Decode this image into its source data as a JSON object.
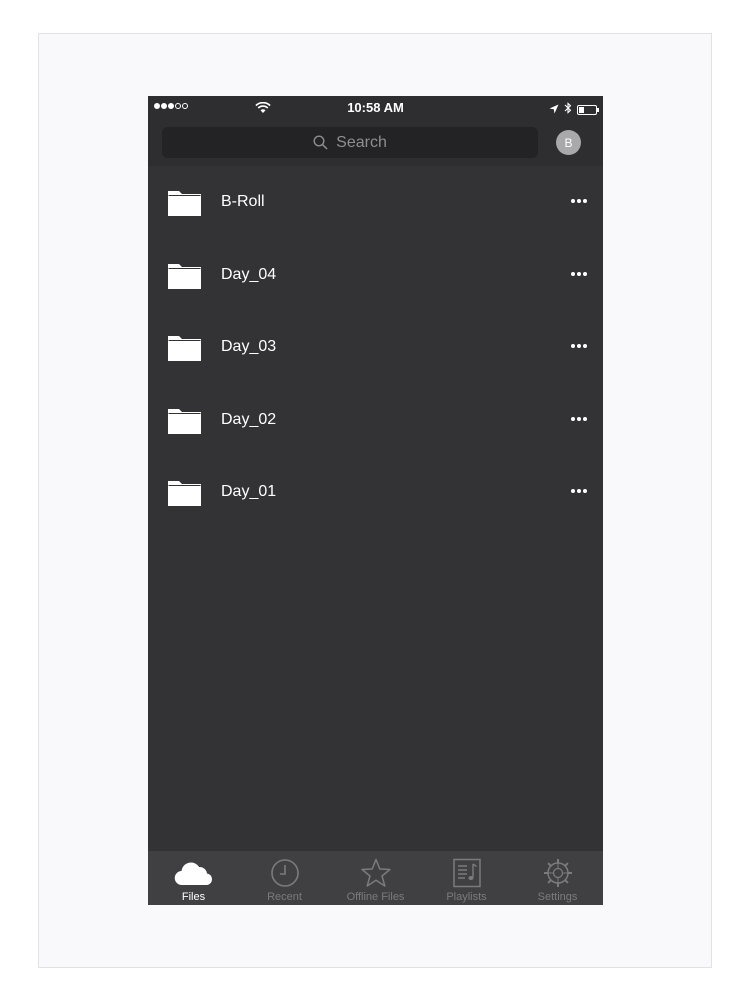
{
  "status_bar": {
    "time": "10:58 AM",
    "signal_bars_filled": 3,
    "signal_bars_total": 5,
    "battery_level": 0.3
  },
  "search": {
    "placeholder": "Search"
  },
  "account": {
    "avatar_initial": "B"
  },
  "folders": [
    {
      "name": "B-Roll",
      "icon": "folder-icon"
    },
    {
      "name": "Day_04",
      "icon": "folder-icon"
    },
    {
      "name": "Day_03",
      "icon": "folder-icon"
    },
    {
      "name": "Day_02",
      "icon": "folder-icon"
    },
    {
      "name": "Day_01",
      "icon": "folder-icon"
    }
  ],
  "tab_bar": {
    "active": "Files",
    "tabs": [
      {
        "label": "Files",
        "icon": "cloud-icon"
      },
      {
        "label": "Recent",
        "icon": "clock-icon"
      },
      {
        "label": "Offline Files",
        "icon": "star-icon"
      },
      {
        "label": "Playlists",
        "icon": "playlist-icon"
      },
      {
        "label": "Settings",
        "icon": "gear-icon"
      }
    ]
  },
  "colors": {
    "background": "#333234",
    "header": "#2e2d2f",
    "tab_bar": "#403f41",
    "tab_inactive": "#7b7a7d",
    "tab_active": "#ffffff"
  }
}
